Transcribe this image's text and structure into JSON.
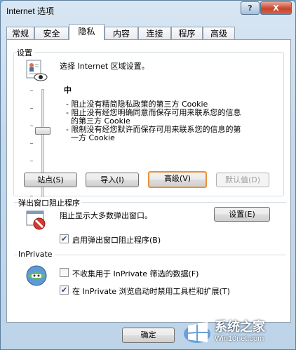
{
  "window": {
    "title": "Internet 选项",
    "help_label": "?",
    "close_label": "X"
  },
  "tabs": [
    {
      "label": "常规"
    },
    {
      "label": "安全"
    },
    {
      "label": "隐私"
    },
    {
      "label": "内容"
    },
    {
      "label": "连接"
    },
    {
      "label": "程序"
    },
    {
      "label": "高级"
    }
  ],
  "settings": {
    "group_title": "设置",
    "zone_text": "选择 Internet 区域设置。",
    "level": "中",
    "bullets": [
      "- 阻止没有精简隐私政策的第三方 Cookie",
      "- 阻止没有经您明确同意而保存可用来联系您的信息\n  的第三方 Cookie",
      "- 限制没有经您默许而保存可用来联系您的信息的第\n  一方 Cookie"
    ],
    "buttons": {
      "sites": "站点(S)",
      "import": "导入(I)",
      "advanced": "高级(V)",
      "default": "默认值(D)"
    }
  },
  "popup": {
    "group_title": "弹出窗口阻止程序",
    "description": "阻止显示大多数弹出窗口。",
    "settings_button": "设置(E)",
    "enable_label": "启用弹出窗口阻止程序(B)",
    "enable_checked": true
  },
  "inprivate": {
    "group_title": "InPrivate",
    "option1": "不收集用于 InPrivate 筛选的数据(F)",
    "option1_checked": false,
    "option2": "在 InPrivate 浏览启动时禁用工具栏和扩展(T)",
    "option2_checked": true
  },
  "footer": {
    "ok_label": "确定"
  },
  "watermark": {
    "line1": "系统之家",
    "line2": "Win10net.com"
  },
  "colors": {
    "focus_border": "#e8913a",
    "check": "#2a4b7c"
  }
}
